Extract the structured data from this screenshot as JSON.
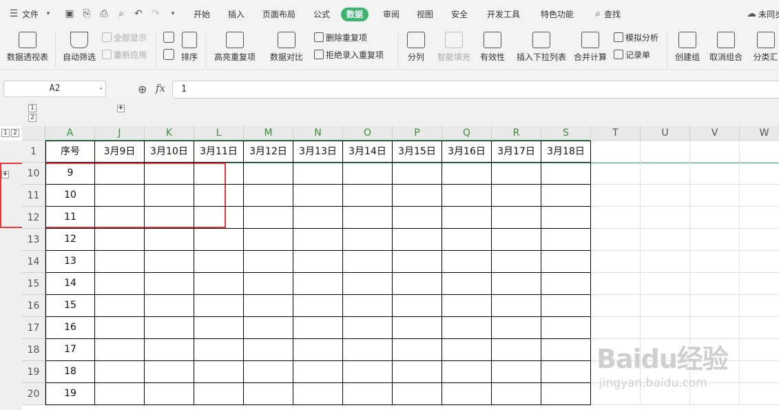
{
  "menubar": {
    "file_label": "文件",
    "tabs": [
      "开始",
      "插入",
      "页面布局",
      "公式",
      "数据",
      "审阅",
      "视图",
      "安全",
      "开发工具",
      "特色功能"
    ],
    "active_tab": "数据",
    "search_label": "查找",
    "sync_label": "未同步"
  },
  "ribbon": {
    "pivot": "数据透视表",
    "autofilter": "自动筛选",
    "show_all": "全部显示",
    "reapply": "重新应用",
    "sort": "排序",
    "highlight_dup": "高亮重复项",
    "data_compare": "数据对比",
    "remove_dup": "删除重复项",
    "reject_dup": "拒绝录入重复项",
    "split": "分列",
    "smart_fill": "智能填充",
    "validity": "有效性",
    "insert_dropdown": "插入下拉列表",
    "merge_calc": "合并计算",
    "simulate": "模拟分析",
    "record": "记录单",
    "create_group": "创建组",
    "ungroup": "取消组合",
    "subtotal": "分类汇"
  },
  "formula": {
    "name_box": "A2",
    "fx": "fx",
    "value": "1"
  },
  "outline": {
    "col_levels": [
      "1",
      "2"
    ],
    "row_levels": [
      "1",
      "2"
    ],
    "expand": "+"
  },
  "sheet": {
    "columns": [
      "A",
      "J",
      "K",
      "L",
      "M",
      "N",
      "O",
      "P",
      "Q",
      "R",
      "S",
      "T",
      "U",
      "V",
      "W"
    ],
    "header_row": [
      "序号",
      "3月9日",
      "3月10日",
      "3月11日",
      "3月12日",
      "3月13日",
      "3月14日",
      "3月15日",
      "3月16日",
      "3月17日",
      "3月18日"
    ],
    "rows": [
      {
        "num": "1",
        "a": "序号"
      },
      {
        "num": "10",
        "a": "9"
      },
      {
        "num": "11",
        "a": "10"
      },
      {
        "num": "12",
        "a": "11"
      },
      {
        "num": "13",
        "a": "12"
      },
      {
        "num": "14",
        "a": "13"
      },
      {
        "num": "15",
        "a": "14"
      },
      {
        "num": "16",
        "a": "15"
      },
      {
        "num": "17",
        "a": "16"
      },
      {
        "num": "18",
        "a": "17"
      },
      {
        "num": "19",
        "a": "18"
      },
      {
        "num": "20",
        "a": "19"
      }
    ]
  },
  "watermark": {
    "logo": "Baidu经验",
    "url": "jingyan.baidu.com"
  },
  "colors": {
    "accent": "#3cb371",
    "highlight": "#e3393c"
  }
}
